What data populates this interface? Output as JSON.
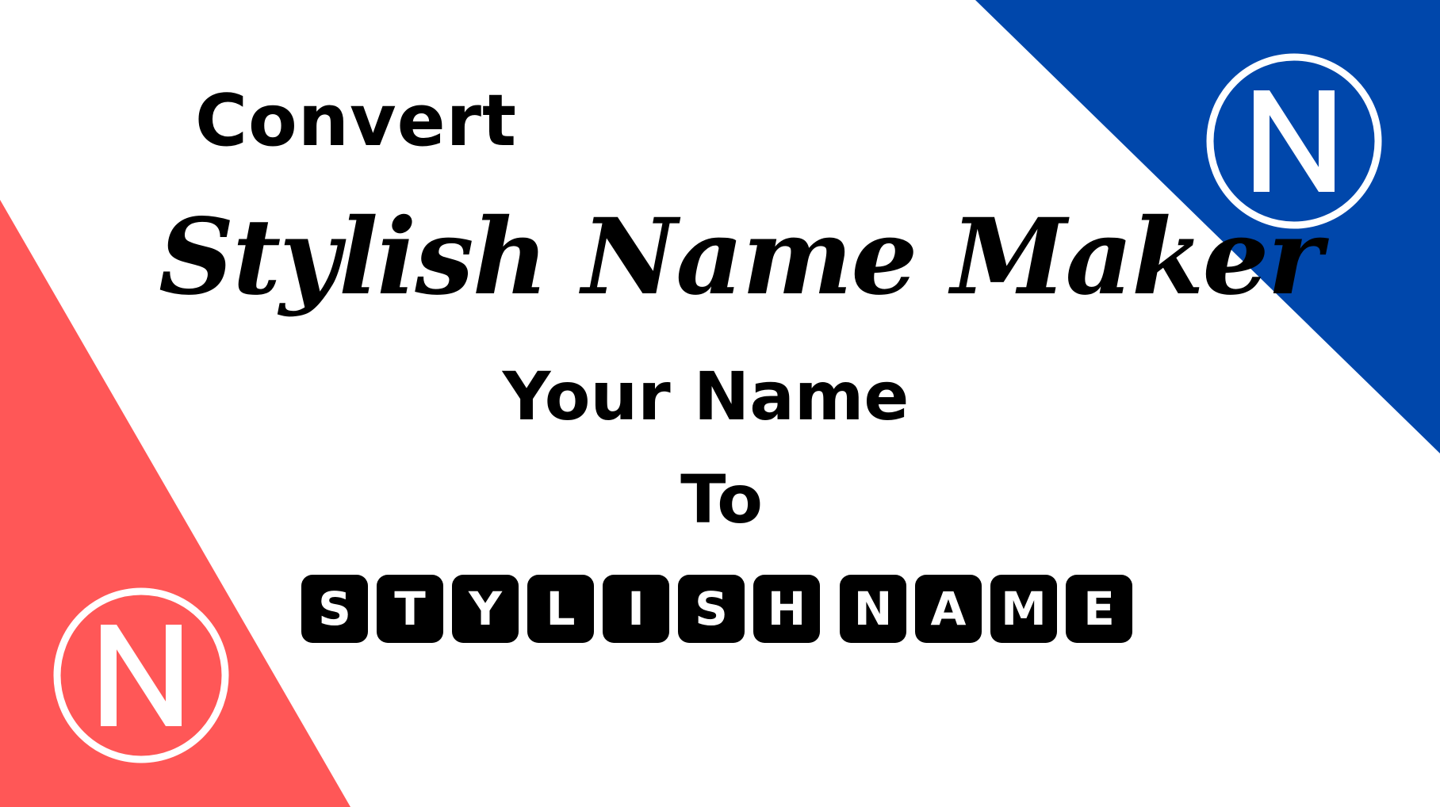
{
  "colors": {
    "background": "#ffffff",
    "blue_corner": "#0047ab",
    "red_corner": "#ff5757",
    "text": "#000000",
    "tile_background": "#000000",
    "tile_text": "#ffffff",
    "logo_ring": "#ffffff"
  },
  "logos": {
    "top_right": {
      "letter": "N",
      "icon": "n-logo-icon"
    },
    "bottom_left": {
      "letter": "N",
      "icon": "n-logo-icon"
    }
  },
  "headline": {
    "convert": "Convert",
    "script_title": "Stylish Name Maker",
    "your_name": "Your Name",
    "to": "To"
  },
  "tiles": {
    "word1": [
      "S",
      "T",
      "Y",
      "L",
      "I",
      "S",
      "H"
    ],
    "word2": [
      "N",
      "A",
      "M",
      "E"
    ]
  }
}
